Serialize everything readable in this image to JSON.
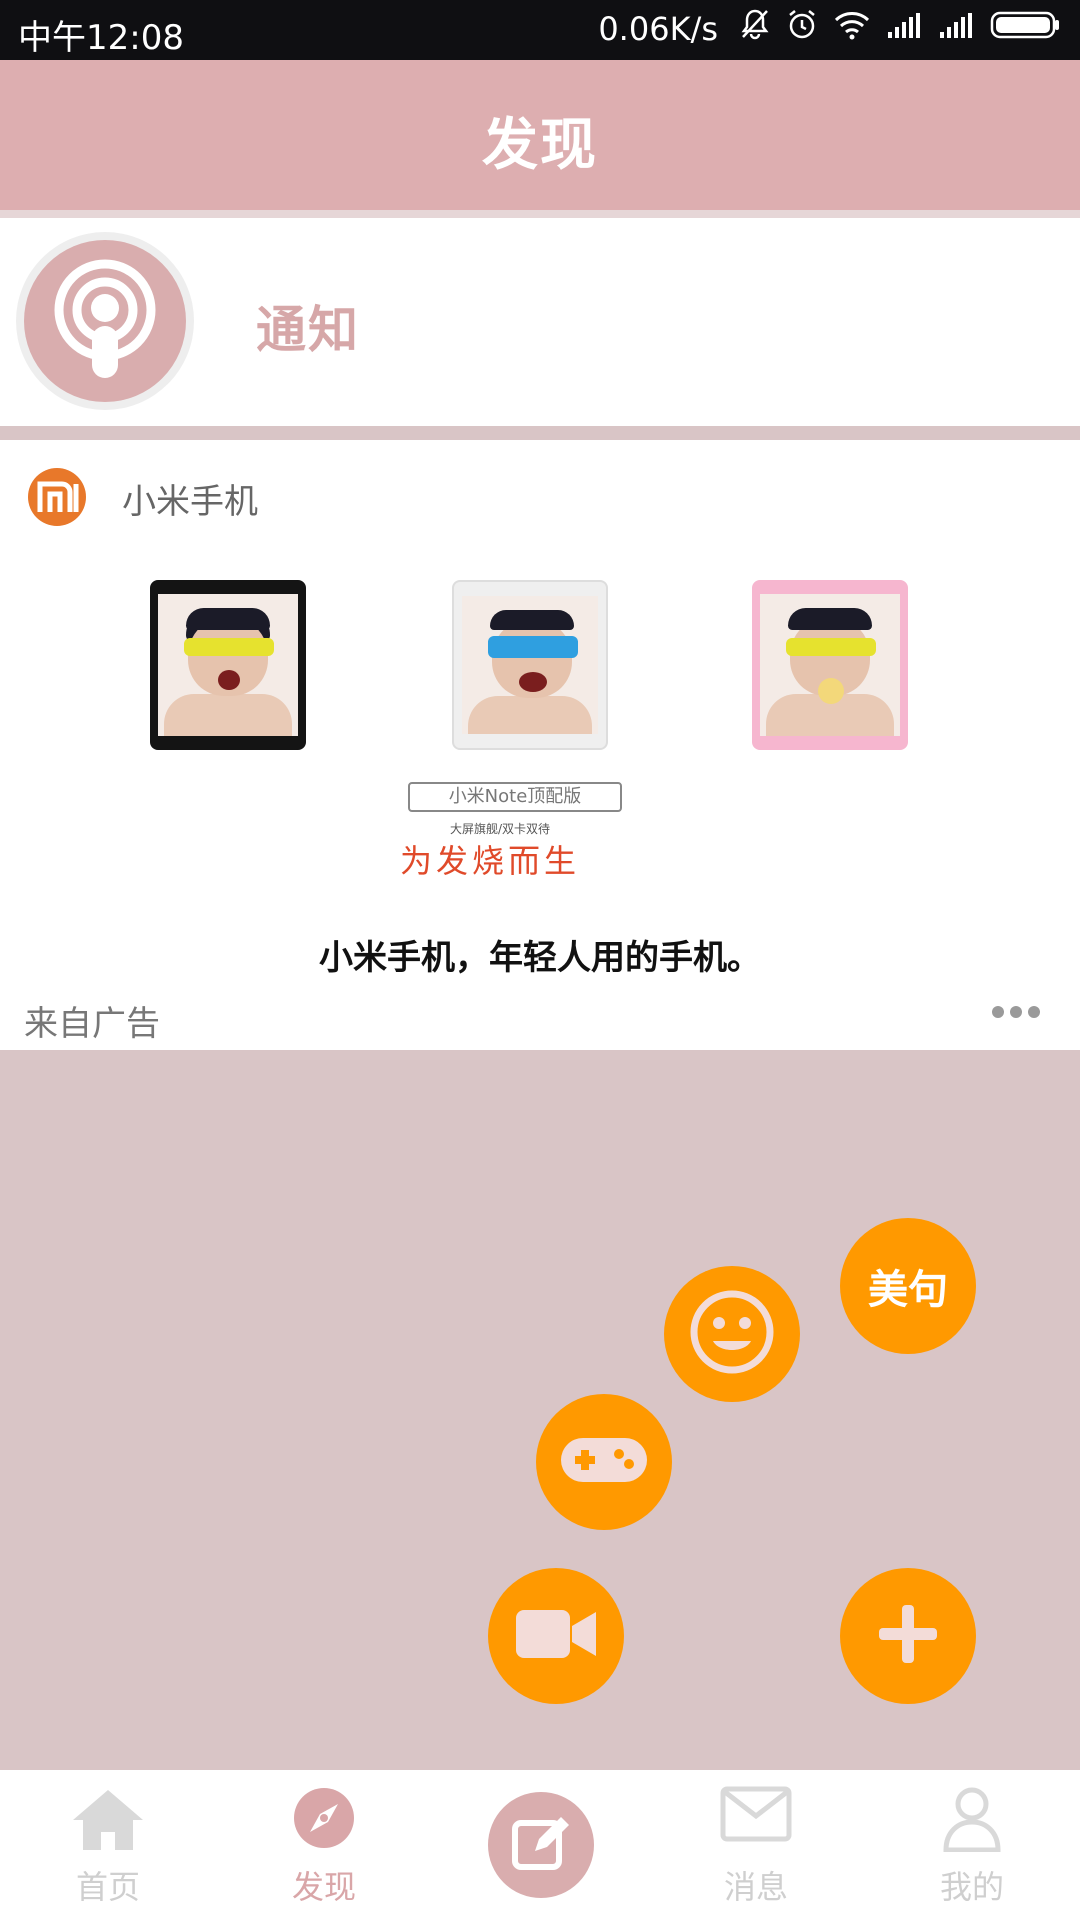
{
  "status_bar": {
    "time": "中午12:08",
    "network_speed": "0.06K/s",
    "icons": [
      "mute-bell-icon",
      "alarm-icon",
      "wifi-icon",
      "signal-icon",
      "signal-icon",
      "battery-icon"
    ]
  },
  "header": {
    "title": "发现"
  },
  "notification": {
    "label": "通知",
    "icon": "podcast-broadcast-icon"
  },
  "ad": {
    "brand_name": "小米手机",
    "banner": {
      "product_box": "小米Note顶配版",
      "subline": "大屏旗舰/双卡双待",
      "slogan": "为发烧而生"
    },
    "caption": "小米手机，年轻人用的手机。",
    "source_label": "来自广告"
  },
  "fabs": {
    "quote_label": "美句",
    "icons": [
      "smiley-icon",
      "gamepad-icon",
      "video-camera-icon",
      "plus-icon"
    ]
  },
  "tabbar": {
    "items": [
      {
        "label": "首页",
        "icon": "home-icon"
      },
      {
        "label": "发现",
        "icon": "compass-icon"
      },
      {
        "label": "",
        "icon": "edit-icon"
      },
      {
        "label": "消息",
        "icon": "mail-icon"
      },
      {
        "label": "我的",
        "icon": "user-icon"
      }
    ],
    "active_index": 1
  },
  "colors": {
    "header_bg": "#ddaeb0",
    "accent_pink": "#d9adae",
    "fab_orange": "#ff9900",
    "page_bg": "#d9c5c6",
    "ad_orange": "#e8782a"
  }
}
